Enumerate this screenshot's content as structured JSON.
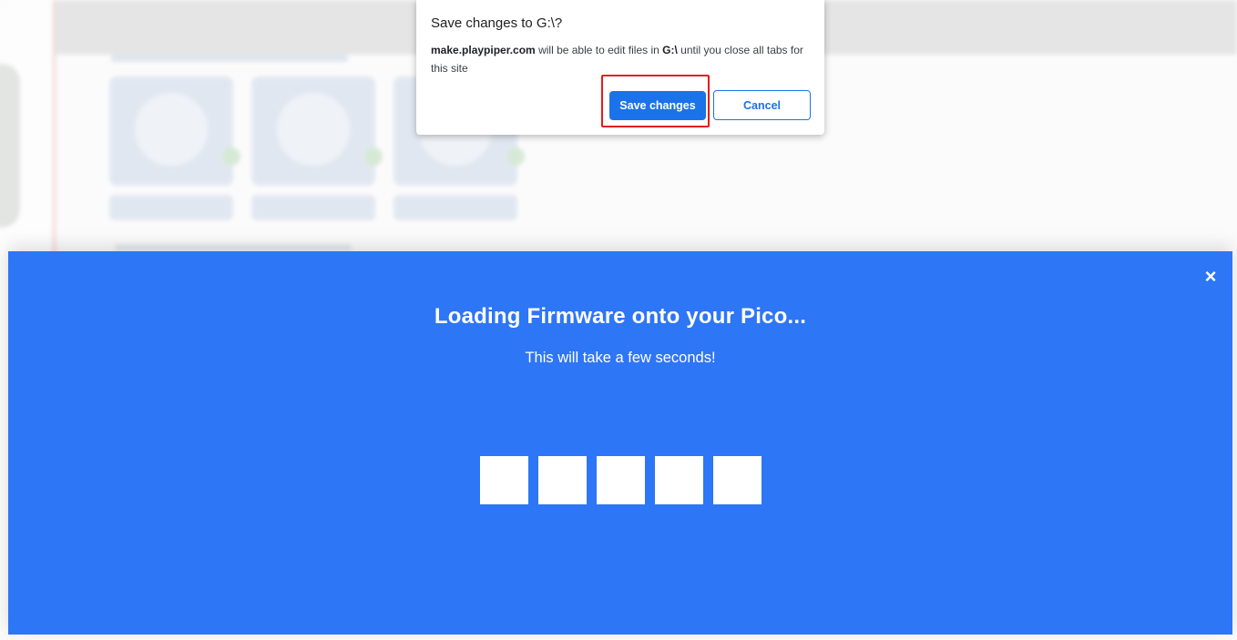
{
  "dialog": {
    "title": "Save changes to G:\\?",
    "site": "make.playpiper.com",
    "text_middle": " will be able to edit files in ",
    "drive": "G:\\",
    "text_end": " until you close all tabs for this site",
    "save_label": "Save changes",
    "cancel_label": "Cancel"
  },
  "loading": {
    "title": "Loading Firmware onto your Pico...",
    "subtitle": "This will take a few seconds!",
    "close_icon": "×",
    "blocks": 5
  },
  "colors": {
    "modal_blue": "#2d76f5",
    "primary_button": "#1a73e8",
    "highlight_red": "#e8191b"
  }
}
